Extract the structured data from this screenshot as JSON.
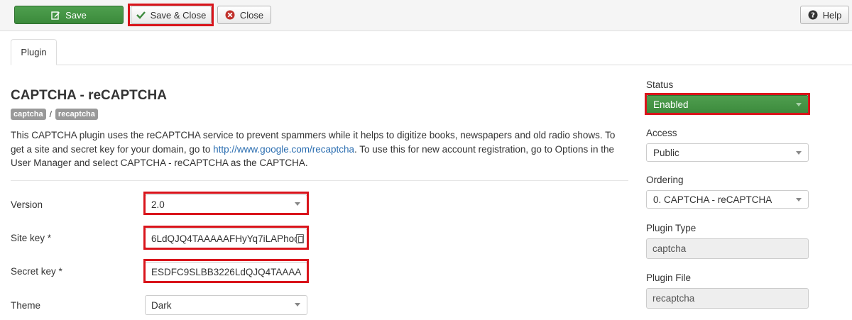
{
  "toolbar": {
    "save_label": "Save",
    "save_close_label": "Save & Close",
    "close_label": "Close",
    "help_label": "Help"
  },
  "tabs": [
    {
      "label": "Plugin"
    }
  ],
  "plugin": {
    "title": "CAPTCHA - reCAPTCHA",
    "tags": [
      "captcha",
      "recaptcha"
    ],
    "tag_separator": "/",
    "description_before": "This CAPTCHA plugin uses the reCAPTCHA service to prevent spammers while it helps to digitize books, newspapers and old radio shows. To get a site and secret key for your domain, go to ",
    "description_link": "http://www.google.com/recaptcha",
    "description_after": ". To use this for new account registration, go to Options in the User Manager and select CAPTCHA - reCAPTCHA as the CAPTCHA."
  },
  "fields": {
    "version": {
      "label": "Version",
      "value": "2.0"
    },
    "site_key": {
      "label": "Site key *",
      "value": "6LdQJQ4TAAAAAFHyYq7iLAPhoc"
    },
    "secret_key": {
      "label": "Secret key *",
      "value": "ESDFC9SLBB3226LdQJQ4TAAAA"
    },
    "theme": {
      "label": "Theme",
      "value": "Dark"
    }
  },
  "sidebar": {
    "status": {
      "label": "Status",
      "value": "Enabled"
    },
    "access": {
      "label": "Access",
      "value": "Public"
    },
    "ordering": {
      "label": "Ordering",
      "value": "0. CAPTCHA - reCAPTCHA"
    },
    "plugin_type": {
      "label": "Plugin Type",
      "value": "captcha"
    },
    "plugin_file": {
      "label": "Plugin File",
      "value": "recaptcha"
    }
  },
  "colors": {
    "primary_green": "#46954a",
    "highlight_red": "#d9141b",
    "link_blue": "#2a6db0",
    "tag_gray": "#999999"
  },
  "icons": {
    "save": "edit-icon",
    "save_close": "checkmark-icon",
    "close": "cancel-circle-icon",
    "help": "question-circle-icon"
  }
}
